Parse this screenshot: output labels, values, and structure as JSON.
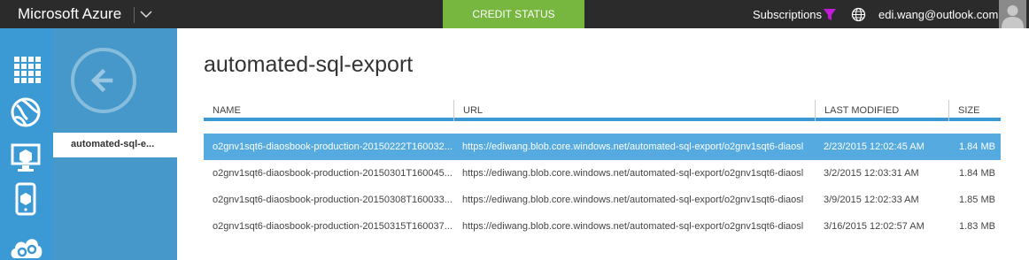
{
  "topbar": {
    "brand": "Microsoft Azure",
    "credit_status": "CREDIT STATUS",
    "subscriptions": "Subscriptions",
    "email": "edi.wang@outlook.com"
  },
  "panel": {
    "selected_item": "automated-sql-e..."
  },
  "main": {
    "title": "automated-sql-export",
    "columns": [
      "NAME",
      "URL",
      "LAST MODIFIED",
      "SIZE"
    ],
    "rows": [
      {
        "name": "o2gnv1sqt6-diaosbook-production-20150222T160032...",
        "url": "https://ediwang.blob.core.windows.net/automated-sql-export/o2gnv1sqt6-diaosl",
        "modified": "2/23/2015 12:02:45 AM",
        "size": "1.84 MB"
      },
      {
        "name": "o2gnv1sqt6-diaosbook-production-20150301T160045...",
        "url": "https://ediwang.blob.core.windows.net/automated-sql-export/o2gnv1sqt6-diaosl",
        "modified": "3/2/2015 12:03:31 AM",
        "size": "1.84 MB"
      },
      {
        "name": "o2gnv1sqt6-diaosbook-production-20150308T160033...",
        "url": "https://ediwang.blob.core.windows.net/automated-sql-export/o2gnv1sqt6-diaosl",
        "modified": "3/9/2015 12:02:33 AM",
        "size": "1.85 MB"
      },
      {
        "name": "o2gnv1sqt6-diaosbook-production-20150315T160037...",
        "url": "https://ediwang.blob.core.windows.net/automated-sql-export/o2gnv1sqt6-diaosl",
        "modified": "3/16/2015 12:02:57 AM",
        "size": "1.83 MB"
      }
    ],
    "selected_row": 0
  },
  "colors": {
    "topbar_bg": "#2b2b2b",
    "credit_green": "#77b740",
    "rail_blue": "#3b9ad4",
    "panel_blue": "#4598c9",
    "selection_blue": "#55aadf",
    "filter_magenta": "#c21bd6"
  },
  "icons": {
    "rail": [
      "all-items-grid-icon",
      "web-sites-icon",
      "virtual-machines-icon",
      "mobile-services-icon",
      "cloud-services-icon"
    ],
    "topbar": [
      "chevron-down-icon",
      "filter-icon",
      "globe-icon",
      "avatar-icon"
    ],
    "panel": [
      "back-arrow-icon"
    ]
  }
}
